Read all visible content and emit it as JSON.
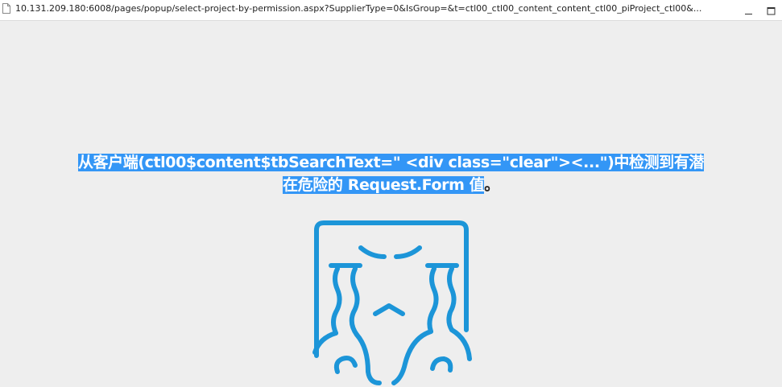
{
  "window": {
    "url": "10.131.209.180:6008/pages/popup/select-project-by-permission.aspx?SupplierType=0&IsGroup=&t=ctl00_ctl00_content_content_ctl00_piProject_ctl00&..."
  },
  "error": {
    "line1": "从客户端(ctl00$content$tbSearchText=\"   <div class=\"clear\"><...\")中检测到有潜",
    "line2_selected": "在危险的 Request.Form 值",
    "line2_tail": "。"
  },
  "icons": {
    "page": "page-icon",
    "minimize": "minimize-icon",
    "maximize": "maximize-icon",
    "illustration": "crying-face-icon"
  },
  "colors": {
    "selection": "#3396f6",
    "illustration": "#1c95d8",
    "background": "#eeeeee"
  }
}
